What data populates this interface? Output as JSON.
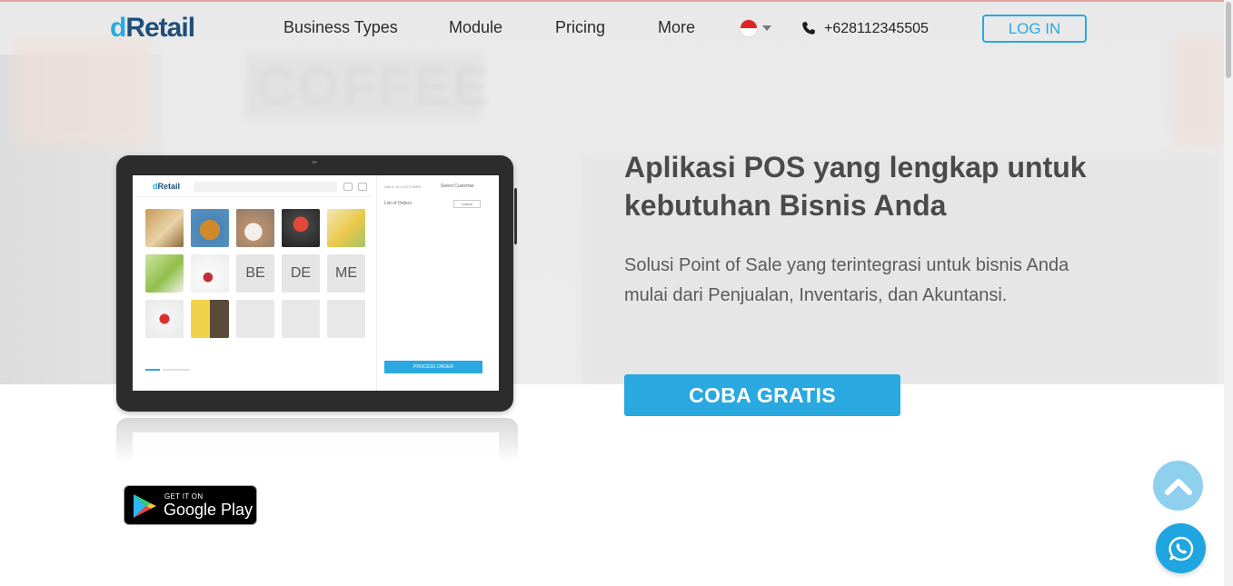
{
  "header": {
    "logo_d": "d",
    "logo_rest": "Retail",
    "nav": [
      "Business Types",
      "Module",
      "Pricing",
      "More"
    ],
    "language_flag": "indonesia-flag",
    "phone": "+628112345505",
    "login_label": "LOG IN"
  },
  "hero": {
    "bg_word": "COFFEE",
    "title": "Aplikasi POS yang lengkap untuk kebutuhan Bisnis Anda",
    "subtitle": "Solusi Point of Sale yang terintegrasi untuk bisnis Anda mulai dari Penjualan, Inventaris, dan Akuntansi.",
    "cta_label": "COBA GRATIS"
  },
  "tablet_screen": {
    "logo_d": "d",
    "logo_rest": "Retail",
    "tiles": [
      "BE",
      "DE",
      "ME"
    ],
    "right_header_left": "WALK-IN CUSTOMER",
    "right_header_right": "Select Customer",
    "orders_label": "List of Orders",
    "orders_button": "Unlock",
    "process_label": "PROCESS ORDER"
  },
  "google_play": {
    "small": "GET IT ON",
    "big": "Google Play"
  },
  "colors": {
    "accent": "#29a9e0",
    "brand_dark": "#1e4f7a",
    "scroll_top_bg": "#8fd0ef"
  }
}
